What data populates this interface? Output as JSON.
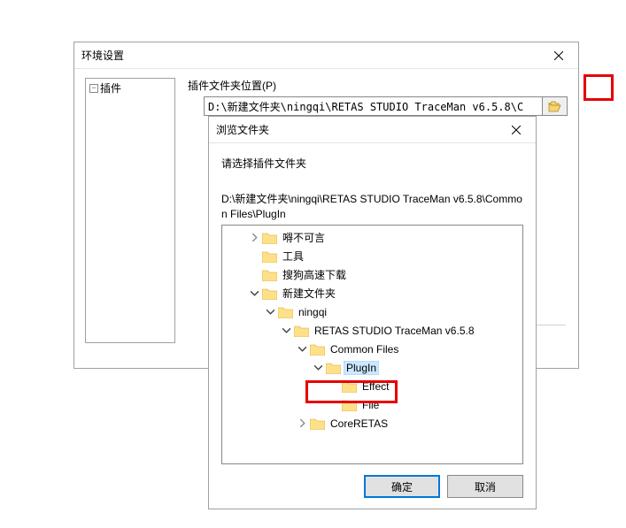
{
  "envDialog": {
    "title": "环境设置",
    "treeRoot": "插件",
    "fieldLabel": "插件文件夹位置(P)",
    "pathValue": "D:\\新建文件夹\\ningqi\\RETAS STUDIO TraceMan v6.5.8\\C"
  },
  "browseDialog": {
    "title": "浏览文件夹",
    "prompt": "请选择插件文件夹",
    "currentPath": "D:\\新建文件夹\\ningqi\\RETAS STUDIO TraceMan v6.5.8\\Common Files\\PlugIn",
    "okLabel": "确定",
    "cancelLabel": "取消"
  },
  "tree": {
    "n0": "嘚不可言",
    "n1": "工具",
    "n2": "搜狗高速下载",
    "n3": "新建文件夹",
    "n4": "ningqi",
    "n5": "RETAS STUDIO TraceMan v6.5.8",
    "n6": "Common Files",
    "n7": "PlugIn",
    "n8": "Effect",
    "n9": "File",
    "n10": "CoreRETAS"
  }
}
